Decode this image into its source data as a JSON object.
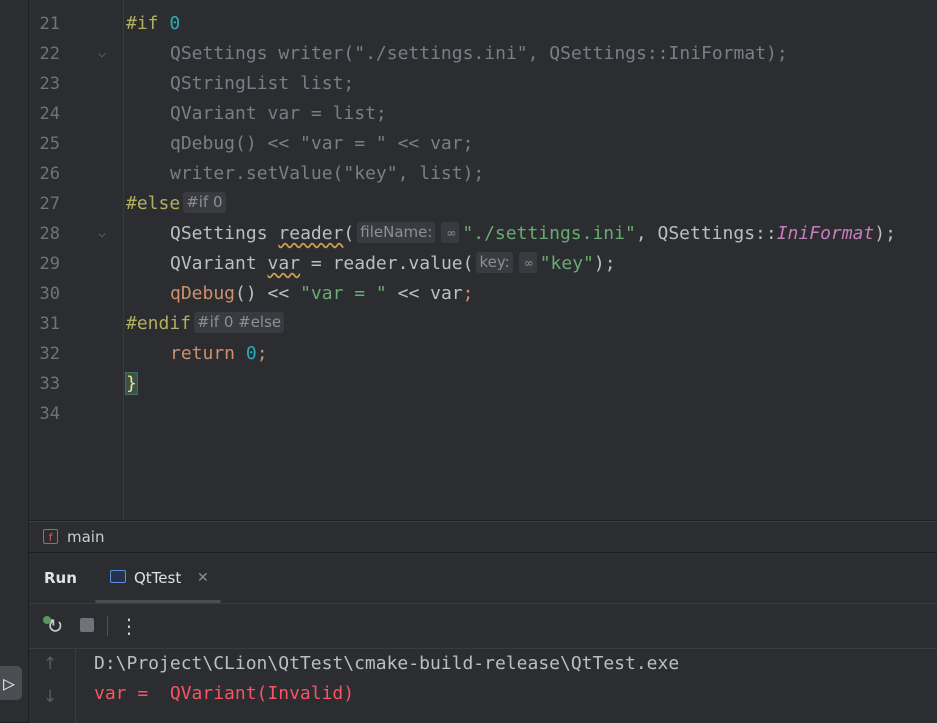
{
  "editor": {
    "line_numbers": [
      "21",
      "22",
      "23",
      "24",
      "25",
      "26",
      "27",
      "28",
      "29",
      "30",
      "31",
      "32",
      "33",
      "34"
    ],
    "folded_lines": [
      "22",
      "28"
    ],
    "hints": {
      "else_hint": "#if 0",
      "endif_hint": "#if 0 #else",
      "filename_param": "fileName:",
      "key_param": "key:"
    },
    "code": {
      "l21_directive": "#if",
      "l21_value": "0",
      "l22": "QSettings writer(\"./settings.ini\", QSettings::IniFormat);",
      "l23": "QStringList list;",
      "l24": "QVariant var = list;",
      "l25": "qDebug() << \"var = \" << var;",
      "l26": "writer.setValue(\"key\", list);",
      "l27": "#else",
      "l28_type": "QSettings",
      "l28_var": "reader",
      "l28_str": "\"./settings.ini\"",
      "l28_scope": "QSettings::",
      "l28_enum": "IniFormat",
      "l29_type": "QVariant",
      "l29_var": "var",
      "l29_call": "reader.value(",
      "l29_str": "\"key\"",
      "l30_fn": "qDebug",
      "l30_str": "\"var = \"",
      "l30_var": "var",
      "l31": "#endif",
      "l32_kw": "return",
      "l32_num": "0",
      "l33": "}"
    }
  },
  "breadcrumb": {
    "icon": "f",
    "label": "main"
  },
  "run_window": {
    "title": "Run",
    "tab_label": "QtTest",
    "tab_close": "✕",
    "console": [
      "D:\\Project\\CLion\\QtTest\\cmake-build-release\\QtTest.exe",
      "var =  QVariant(Invalid)"
    ]
  },
  "icons": {
    "run_gutter": "run-triangle-icon",
    "rerun": "rerun-icon",
    "stop": "stop-icon",
    "more": "more-vertical-icon",
    "scroll_up": "arrow-up-icon",
    "scroll_down": "arrow-down-icon",
    "param_hint": "link-icon"
  },
  "colors": {
    "background": "#2b2d30",
    "preprocessor": "#b3ae60",
    "string": "#6aab73",
    "keyword": "#cf8e6d",
    "number": "#2aacb8",
    "error_output": "#f75464"
  }
}
